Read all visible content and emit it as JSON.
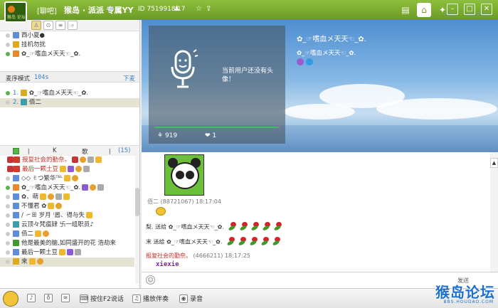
{
  "titlebar": {
    "tag": "[聊吧]",
    "room_name": "猴岛 · 派派  专属YY",
    "room_id": "ID 7519918",
    "member_count": "17",
    "logo_text": "猴岛 论坛"
  },
  "left": {
    "top_users": [
      {
        "name": "西小夏●",
        "online": false,
        "avatar": "blue"
      },
      {
        "name": "挂机勿扰",
        "online": false,
        "avatar": "gold"
      },
      {
        "name": "✿_☞嗜血メ天天☜_✿.",
        "online": true,
        "avatar": "orange"
      }
    ],
    "queue": {
      "mode_label": "麦序模式",
      "timer": "104s",
      "down_label": "下麦",
      "items": [
        {
          "index": "1.",
          "name": "✿_☞嗜血メ天天☜_✿."
        },
        {
          "index": "2.",
          "name": "佰二"
        }
      ]
    },
    "members_head": {
      "c1": "丨",
      "c2": "K",
      "c3": "歌",
      "c4": "丨",
      "count": "(15)"
    },
    "members": [
      {
        "name": "报复社会的勤奈。",
        "red": true,
        "avatar": "red",
        "selected": false
      },
      {
        "name": "最后一颗土豆",
        "red": true,
        "avatar": "red",
        "selected": false
      },
      {
        "name": "◇◇ ✌つ繁华ᵀᴱᴸ",
        "red": false,
        "avatar": "blue",
        "selected": false
      },
      {
        "name": "✿_☞嗜血メ天天☜_✿.",
        "red": false,
        "avatar": "orange",
        "selected": false
      },
      {
        "name": "✿、萌",
        "red": false,
        "avatar": "blue",
        "selected": false
      },
      {
        "name": "不懂君 ✿",
        "red": false,
        "avatar": "blue",
        "selected": false
      },
      {
        "name": "/ ㇀ꕥ 岁月 ⁽嚣、得与失",
        "red": false,
        "avatar": "blue",
        "selected": false
      },
      {
        "name": "云顶々梵瘟肄 卐一组职员♪",
        "red": false,
        "avatar": "teal",
        "selected": false
      },
      {
        "name": "佰二",
        "red": false,
        "avatar": "blue",
        "selected": false
      },
      {
        "name": "他是最美的脑,如同盛开的花  浩劫来",
        "red": false,
        "avatar": "green",
        "selected": false
      },
      {
        "name": "最后一颗土豆",
        "red": false,
        "avatar": "blue",
        "selected": false
      },
      {
        "name": "来",
        "red": false,
        "avatar": "blue",
        "selected": true
      }
    ]
  },
  "banner": {
    "video_message": "当前用户还没有头像！",
    "flowers_count": "919",
    "likes_count": "1",
    "host_name": "✿_☞嗜血メ天天☜_✿.",
    "host_sub": "✿_☞嗜血メ天天☜_✿."
  },
  "chat": {
    "msg1_author": "佰二",
    "msg1_meta": "(88721067) 18:17:04",
    "gift1_from": "梨.",
    "gift1_verb": "送给",
    "gift1_to": "✿_☞嗜血メ天天☜_✿.",
    "gift2_from": "末",
    "gift2_verb": "送给",
    "gift2_to": "✿_☞嗜血メ天天☜_✿.",
    "msg2_author": "报复社会的勤奈。",
    "msg2_meta": "(4666211) 18:17:25",
    "msg2_text": "xiexie"
  },
  "input": {
    "send_label": "发送"
  },
  "bottombar": {
    "hold_to_talk": "按住F2说话",
    "play_music": "播放伴奏",
    "record": "录音"
  },
  "watermark": {
    "main": "猴岛论坛",
    "sub": "BBS.HOUDAO.COM"
  },
  "colors": {
    "titlebar": "#7aaa2e",
    "red_name": "#c0322a",
    "link_blue": "#3a7fc6"
  }
}
